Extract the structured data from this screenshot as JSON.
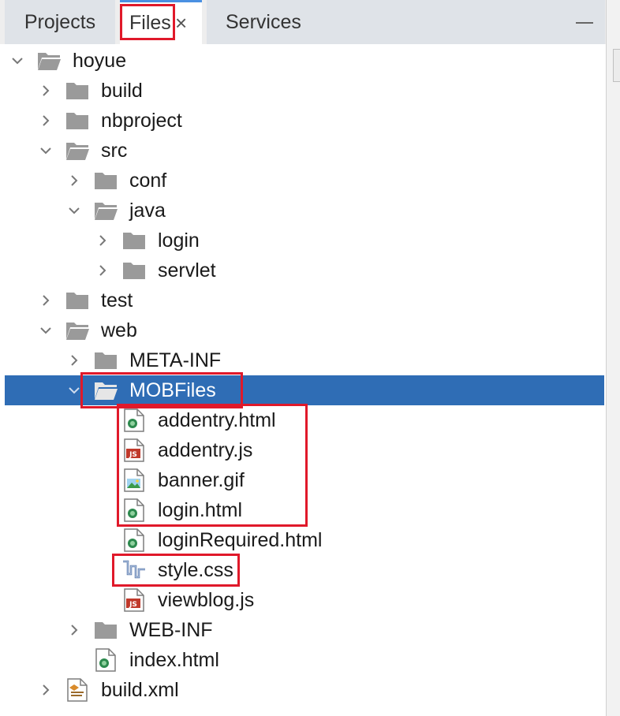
{
  "tabs": {
    "projects": "Projects",
    "files": "Files",
    "files_close": "×",
    "services": "Services"
  },
  "tree": {
    "root": "hoyue",
    "build": "build",
    "nbproject": "nbproject",
    "src": "src",
    "conf": "conf",
    "java": "java",
    "login": "login",
    "servlet": "servlet",
    "test": "test",
    "web": "web",
    "meta_inf": "META-INF",
    "mobfiles": "MOBFiles",
    "addentry_html": "addentry.html",
    "addentry_js": "addentry.js",
    "banner_gif": "banner.gif",
    "login_html": "login.html",
    "loginrequired_html": "loginRequired.html",
    "style_css": "style.css",
    "viewblog_js": "viewblog.js",
    "web_inf": "WEB-INF",
    "index_html": "index.html",
    "build_xml": "build.xml"
  },
  "colors": {
    "selection": "#2f6db5",
    "highlight": "#e0192a"
  }
}
